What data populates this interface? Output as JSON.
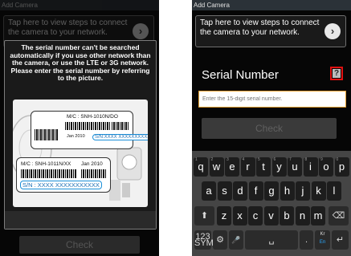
{
  "app_title": "Add Camera",
  "tap_hint": "Tap here to view steps to connect the camera to your network.",
  "arrow_glyph": "›",
  "serial": {
    "title": "Serial Number",
    "help_label": "?",
    "placeholder": "Enter the 15-digit serial number.",
    "check_label": "Check"
  },
  "dialog": {
    "message": "The serial number can't be searched automatically if you use other network than the camera, or use the LTE or 3G network. Please enter the serial number by referring to the picture.",
    "label1_model": "M/C : SNH-1010N/DO",
    "label1_date": "Jan 2010",
    "label1_sn": "S/N:XXXX XXXXXXXXXXX",
    "label2_model": "M/C : SNH-1011N/XX",
    "label2_date": "Jan 2010",
    "label2_sn": "S/N : XXXX XXXXXXXXXXX"
  },
  "left_check_label": "Check",
  "keyboard": {
    "row1": [
      {
        "key": "q",
        "sub": "1"
      },
      {
        "key": "w",
        "sub": "2"
      },
      {
        "key": "e",
        "sub": "3"
      },
      {
        "key": "r",
        "sub": "4"
      },
      {
        "key": "t",
        "sub": "5"
      },
      {
        "key": "y",
        "sub": "6"
      },
      {
        "key": "u",
        "sub": "7"
      },
      {
        "key": "i",
        "sub": "8"
      },
      {
        "key": "o",
        "sub": "9"
      },
      {
        "key": "p",
        "sub": "0"
      }
    ],
    "row2": [
      "a",
      "s",
      "d",
      "f",
      "g",
      "h",
      "j",
      "k",
      "l"
    ],
    "row3": [
      "z",
      "x",
      "c",
      "v",
      "b",
      "n",
      "m"
    ],
    "shift": "⬆",
    "backspace": "⌫",
    "sym": "123\nSYM",
    "gear": "⚙",
    "mic": "🎤",
    "space": "␣",
    "period": ".",
    "lang_top": "Kr",
    "lang_bottom": "En",
    "enter": "↵"
  }
}
